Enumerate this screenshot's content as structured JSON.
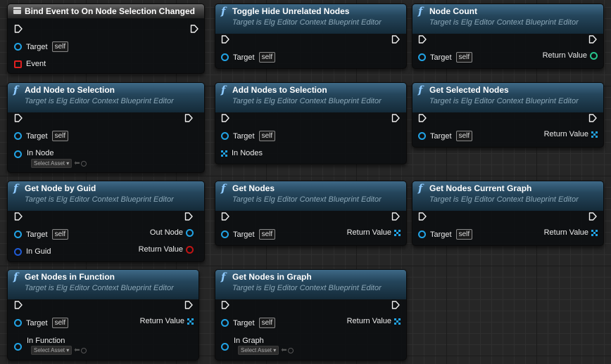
{
  "colors": {
    "object_pin": "#21a3e5",
    "guid_pin": "#1f5bd6",
    "struct_red": "#c01414",
    "int_green": "#27c58c",
    "function_header": "#25465c",
    "event_header": "#3e3e3e"
  },
  "icons": {
    "function": "f",
    "event": "event-node-icon"
  },
  "common": {
    "target_label": "Target",
    "self_label": "self",
    "subtitle": "Target is Elg Editor Context Blueprint Editor",
    "return_value": "Return Value",
    "select_asset": "Select Asset"
  },
  "nodes": {
    "bind_event": {
      "title": "Bind Event to On Node Selection Changed",
      "event_pin": "Event"
    },
    "toggle_hide": {
      "title": "Toggle Hide Unrelated Nodes"
    },
    "node_count": {
      "title": "Node Count"
    },
    "add_node": {
      "title": "Add Node to Selection",
      "in_pin": "In Node"
    },
    "add_nodes": {
      "title": "Add Nodes to Selection",
      "in_pin": "In Nodes"
    },
    "get_selected": {
      "title": "Get Selected Nodes"
    },
    "get_by_guid": {
      "title": "Get Node by Guid",
      "in_pin": "In Guid",
      "out_pin": "Out Node"
    },
    "get_nodes": {
      "title": "Get Nodes"
    },
    "get_current_graph": {
      "title": "Get Nodes Current Graph"
    },
    "get_in_function": {
      "title": "Get Nodes in Function",
      "in_pin": "In Function"
    },
    "get_in_graph": {
      "title": "Get Nodes in Graph",
      "in_pin": "In Graph"
    }
  }
}
